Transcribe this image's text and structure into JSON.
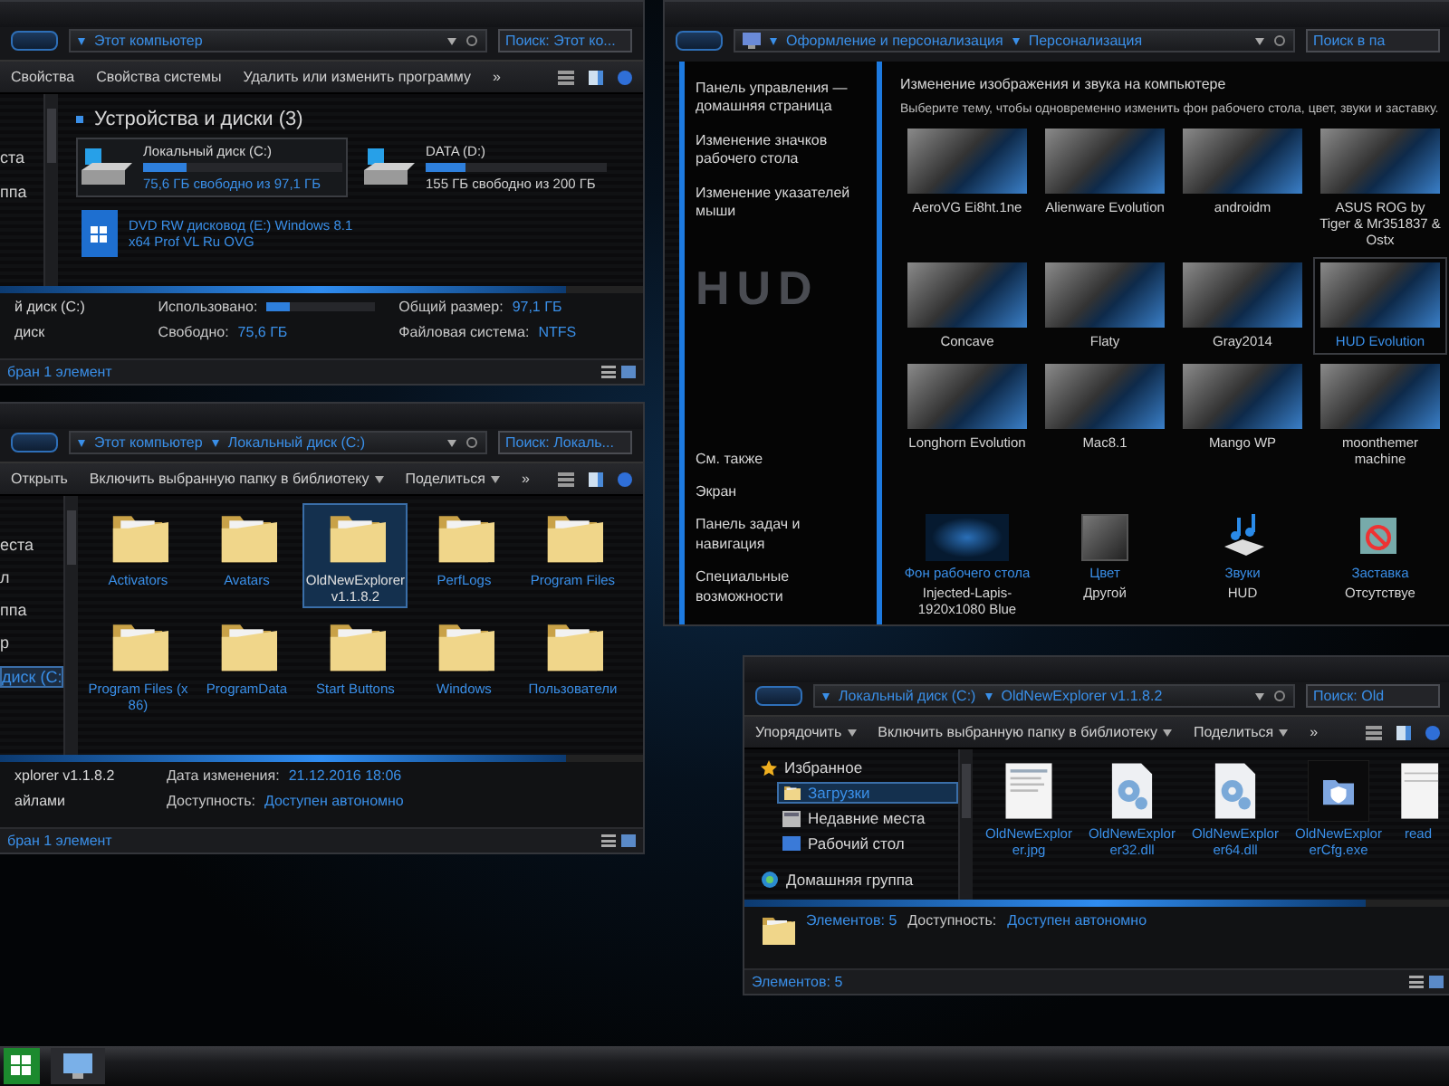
{
  "computer_window": {
    "address": [
      "Этот компьютер"
    ],
    "search": {
      "placeholder": "Поиск: Этот ко..."
    },
    "toolbar": [
      {
        "label": "Свойства",
        "dropdown": false
      },
      {
        "label": "Свойства системы",
        "dropdown": false
      },
      {
        "label": "Удалить или изменить программу",
        "dropdown": false
      },
      {
        "label": "»",
        "dropdown": false
      }
    ],
    "nav": [
      {
        "label": "ста",
        "selected": false
      },
      {
        "label": "ппа",
        "selected": false
      }
    ],
    "group_title": "Устройства и диски (3)",
    "drives": [
      {
        "kind": "hdd",
        "name": "Локальный диск (C:)",
        "level": 0.22,
        "free": "75,6 ГБ свободно из 97,1 ГБ",
        "selected": true
      },
      {
        "kind": "hdd",
        "name": "DATA (D:)",
        "level": 0.22,
        "free": "155 ГБ свободно из 200 ГБ",
        "selected": false
      },
      {
        "kind": "dvd",
        "name": "DVD RW дисковод (E:) Windows 8.1 x64 Prof VL Ru OVG",
        "selected": false
      }
    ],
    "details": [
      {
        "lead": "й диск (C:)",
        "fields": [
          {
            "kind": "bar",
            "label": "Использовано:",
            "level": 0.22
          },
          {
            "kind": "text",
            "label": "Общий размер:",
            "value": "97,1 ГБ"
          }
        ]
      },
      {
        "lead": "диск",
        "fields": [
          {
            "kind": "text",
            "label": "Свободно:",
            "value": "75,6 ГБ"
          },
          {
            "kind": "text",
            "label": "Файловая система:",
            "value": "NTFS"
          }
        ]
      }
    ],
    "status": "бран 1 элемент"
  },
  "drive_c_window": {
    "address": [
      "Этот компьютер",
      "Локальный диск (C:)"
    ],
    "search": {
      "placeholder": "Поиск: Локаль..."
    },
    "toolbar": [
      {
        "label": "Открыть",
        "dropdown": false
      },
      {
        "label": "Включить выбранную папку в библиотеку",
        "dropdown": true
      },
      {
        "label": "Поделиться",
        "dropdown": true
      },
      {
        "label": "»",
        "dropdown": false
      }
    ],
    "nav": [
      {
        "label": "еста",
        "selected": false
      },
      {
        "label": "л",
        "selected": false
      },
      {
        "label": "ппа",
        "selected": false
      },
      {
        "label": "р",
        "selected": false
      },
      {
        "label": "диск (C:",
        "selected": true
      }
    ],
    "items": [
      {
        "kind": "folder",
        "name": "Activators",
        "selected": false
      },
      {
        "kind": "folder",
        "name": "Avatars",
        "selected": false
      },
      {
        "kind": "folder",
        "name": "OldNewExplorer v1.1.8.2",
        "selected": true
      },
      {
        "kind": "folder",
        "name": "PerfLogs",
        "selected": false
      },
      {
        "kind": "folder",
        "name": "Program Files",
        "selected": false
      },
      {
        "kind": "folder",
        "name": "Program Files (x86)",
        "selected": false
      },
      {
        "kind": "folder",
        "name": "ProgramData",
        "selected": false
      },
      {
        "kind": "folder",
        "name": "Start Buttons",
        "selected": false
      },
      {
        "kind": "folder",
        "name": "Windows",
        "selected": false
      },
      {
        "kind": "folder",
        "name": "Пользователи",
        "selected": false
      }
    ],
    "details": [
      {
        "lead": "xplorer v1.1.8.2",
        "fields": [
          {
            "kind": "text",
            "label": "Дата изменения:",
            "value": "21.12.2016 18:06"
          }
        ]
      },
      {
        "lead": "айлами",
        "fields": [
          {
            "kind": "text",
            "label": "Доступность:",
            "value": "Доступен автономно"
          }
        ]
      }
    ],
    "status": "бран 1 элемент"
  },
  "personalization_window": {
    "address": [
      "Оформление и персонализация",
      "Персонализация"
    ],
    "search": {
      "placeholder": "Поиск в па"
    },
    "nav_links": [
      "Панель управления — домашняя страница",
      "Изменение значков рабочего стола",
      "Изменение указателей мыши"
    ],
    "logo": "HUD",
    "see_also_title": "См. также",
    "see_also_links": [
      "Экран",
      "Панель задач и навигация",
      "Специальные возможности"
    ],
    "heading": "Изменение изображения и звука на компьютере",
    "description": "Выберите тему, чтобы одновременно изменить фон рабочего стола, цвет, звуки и заставку.",
    "themes": [
      {
        "name": "AeroVG Ei8ht.1ne",
        "selected": false
      },
      {
        "name": "Alienware Evolution",
        "selected": false
      },
      {
        "name": "androidm",
        "selected": false
      },
      {
        "name": "ASUS ROG by Tiger & Mr351837 & Ostx",
        "selected": false
      },
      {
        "name": "Concave",
        "selected": false
      },
      {
        "name": "Flaty",
        "selected": false
      },
      {
        "name": "Gray2014",
        "selected": false
      },
      {
        "name": "HUD Evolution",
        "selected": true
      },
      {
        "name": "Longhorn Evolution",
        "selected": false
      },
      {
        "name": "Mac8.1",
        "selected": false
      },
      {
        "name": "Mango WP",
        "selected": false
      },
      {
        "name": "moonthemer machine",
        "selected": false
      }
    ],
    "settings": [
      {
        "kind": "wallpaper",
        "title": "Фон рабочего стола",
        "value": "Injected-Lapis-1920x1080 Blue"
      },
      {
        "kind": "color",
        "title": "Цвет",
        "value": "Другой"
      },
      {
        "kind": "sounds",
        "title": "Звуки",
        "value": "HUD"
      },
      {
        "kind": "screensaver",
        "title": "Заставка",
        "value": "Отсутствуе"
      }
    ]
  },
  "app_folder_window": {
    "address": [
      "Локальный диск (C:)",
      "OldNewExplorer v1.1.8.2"
    ],
    "search": {
      "placeholder": "Поиск: Old"
    },
    "toolbar": [
      {
        "label": "Упорядочить",
        "dropdown": true
      },
      {
        "label": "Включить выбранную папку в библиотеку",
        "dropdown": true
      },
      {
        "label": "Поделиться",
        "dropdown": true
      },
      {
        "label": "»",
        "dropdown": false
      }
    ],
    "nav": [
      {
        "kind": "favorites",
        "label": "Избранное",
        "selected": false
      },
      {
        "kind": "downloads",
        "label": "Загрузки",
        "selected": true
      },
      {
        "kind": "recent",
        "label": "Недавние места",
        "selected": false
      },
      {
        "kind": "desktop",
        "label": "Рабочий стол",
        "selected": false
      },
      {
        "kind": "homegroup",
        "label": "Домашняя группа",
        "selected": false
      }
    ],
    "items": [
      {
        "kind": "image",
        "name": "OldNewExplorer.jpg",
        "selected": false
      },
      {
        "kind": "dll",
        "name": "OldNewExplorer32.dll",
        "selected": false
      },
      {
        "kind": "dll",
        "name": "OldNewExplorer64.dll",
        "selected": false
      },
      {
        "kind": "exe",
        "name": "OldNewExplorerCfg.exe",
        "selected": false
      },
      {
        "kind": "text",
        "name": "read",
        "selected": false
      }
    ],
    "details": [
      {
        "lead": "Элементов: 5",
        "fields": [
          {
            "kind": "text",
            "label": "Доступность:",
            "value": "Доступен автономно"
          }
        ]
      }
    ],
    "status": "Элементов: 5"
  }
}
